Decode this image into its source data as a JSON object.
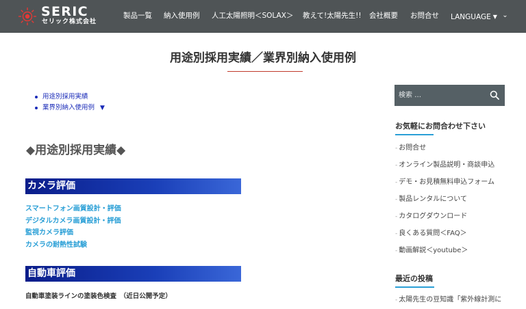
{
  "header": {
    "logo_title": "SERIC",
    "logo_sub": "セリック株式会社",
    "nav": [
      {
        "label": "製品一覧"
      },
      {
        "label": "納入使用例"
      },
      {
        "label": "人工太陽照明＜SOLAX＞"
      },
      {
        "label": "教えて!太陽先生!!"
      },
      {
        "label": "会社概要"
      },
      {
        "label": "お問合せ"
      }
    ],
    "language_label": "LANGUAGE",
    "language_caret": "▼",
    "chevron": "⌄"
  },
  "page": {
    "title": "用途別採用実績／業界別納入使用例",
    "accent": "#c0392b"
  },
  "toc": {
    "items": [
      {
        "label": "用途別採用実績"
      },
      {
        "label": "業界別納入使用例"
      }
    ],
    "toggle": "▼"
  },
  "content": {
    "heading": "◆用途別採用実績◆",
    "sections": [
      {
        "title": "カメラ評価",
        "items": [
          "スマートフォン画質設計・評価",
          "デジタルカメラ画質設計・評価",
          "監視カメラ評価",
          "カメラの耐熱性試験"
        ]
      },
      {
        "title": "自動車評価",
        "items": [
          "自動車塗装ラインの塗装色検査　（近日公開予定）"
        ]
      }
    ]
  },
  "sidebar": {
    "search_placeholder": "検索 …",
    "contact_title": "お気軽にお問合わせ下さい",
    "contact_items": [
      "お問合せ",
      "オンライン製品説明・商談申込",
      "デモ・お見積無料申込フォーム",
      "製品レンタルについて",
      "カタログダウンロード",
      "良くある質問＜FAQ＞",
      "動画解説＜youtube＞"
    ],
    "recent_title": "最近の投稿",
    "recent_items": [
      "太陽先生の豆知識「紫外線計測に"
    ],
    "accent": "#2a9fd6"
  }
}
